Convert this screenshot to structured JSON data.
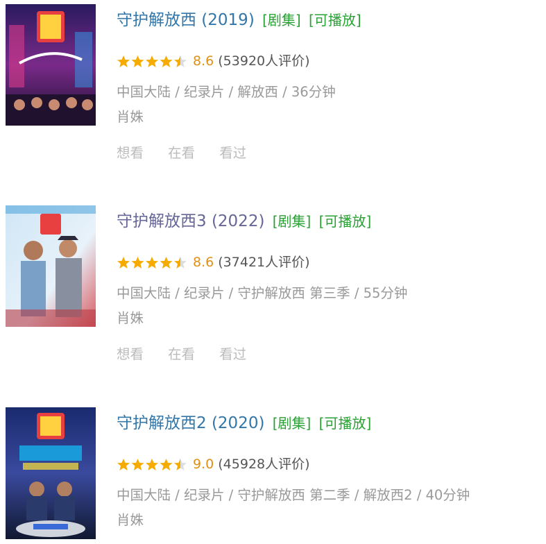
{
  "colors": {
    "title_link": "#3377aa",
    "title_visited": "#666699",
    "tag_green": "#2aa134",
    "star": "#f6ab00",
    "score": "#e09015",
    "meta_gray": "#999999",
    "action_gray": "#bbbbbb"
  },
  "items": [
    {
      "title": "守护解放西 (2019)",
      "tags": [
        "[剧集]",
        "[可播放]"
      ],
      "stars": 4.5,
      "score": "8.6",
      "rating_count": "(53920人评价)",
      "meta": "中国大陆 / 纪录片 / 解放西 / 36分钟",
      "cast": "肖姝",
      "actions": [
        "想看",
        "在看",
        "看过"
      ],
      "poster_icon": "poster-neon-city"
    },
    {
      "title": "守护解放西3 (2022)",
      "tags": [
        "[剧集]",
        "[可播放]"
      ],
      "stars": 4.5,
      "score": "8.6",
      "rating_count": "(37421人评价)",
      "meta": "中国大陆 / 纪录片 / 守护解放西 第三季 / 55分钟",
      "cast": "肖姝",
      "actions": [
        "想看",
        "在看",
        "看过"
      ],
      "poster_icon": "poster-two-officers"
    },
    {
      "title": "守护解放西2 (2020)",
      "tags": [
        "[剧集]",
        "[可播放]"
      ],
      "stars": 4.5,
      "score": "9.0",
      "rating_count": "(45928人评价)",
      "meta": "中国大陆 / 纪录片 / 守护解放西 第二季 / 解放西2 / 40分钟",
      "cast": "肖姝",
      "poster_icon": "poster-police-car"
    }
  ]
}
